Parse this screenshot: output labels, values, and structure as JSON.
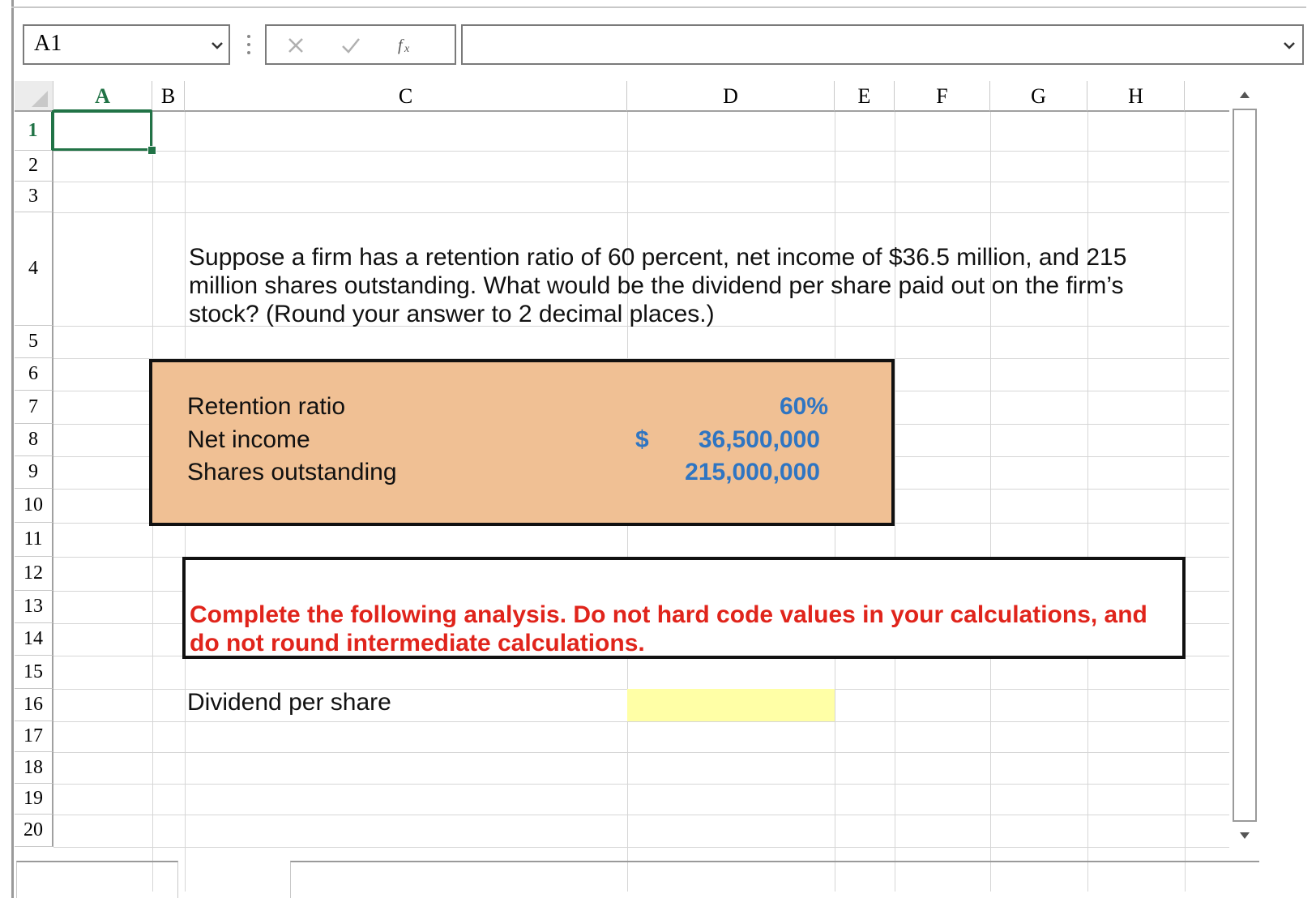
{
  "formula_bar": {
    "name_box": "A1",
    "cancel_symbol": "×",
    "enter_symbol": "✓",
    "fx_label": "fx",
    "formula_value": ""
  },
  "columns": [
    "A",
    "B",
    "C",
    "D",
    "E",
    "F",
    "G",
    "H"
  ],
  "rows": [
    "1",
    "2",
    "3",
    "4",
    "5",
    "6",
    "7",
    "8",
    "9",
    "10",
    "11",
    "12",
    "13",
    "14",
    "15",
    "16",
    "17",
    "18",
    "19",
    "20"
  ],
  "selected_cell": "A1",
  "question": "Suppose a firm has a retention ratio of 60 percent, net income of $36.5 million, and 215 million shares outstanding. What would be the dividend per share paid out on the firm’s stock? (Round your answer to 2 decimal places.)",
  "inputs": {
    "retention_ratio": {
      "label": "Retention ratio",
      "value": "60%"
    },
    "net_income": {
      "label": "Net income",
      "currency": "$",
      "value": "36,500,000"
    },
    "shares_outstanding": {
      "label": "Shares outstanding",
      "value": "215,000,000"
    }
  },
  "instructions": "Complete the following analysis. Do not hard code values in your calculations, and do not round intermediate calculations.",
  "output": {
    "label": "Dividend per share",
    "value": ""
  },
  "colors": {
    "accent_green": "#217346",
    "input_blue": "#2f75c2",
    "instruction_red": "#e0241b",
    "input_box_fill": "#f0c094",
    "answer_cell_fill": "#ffffa6"
  }
}
